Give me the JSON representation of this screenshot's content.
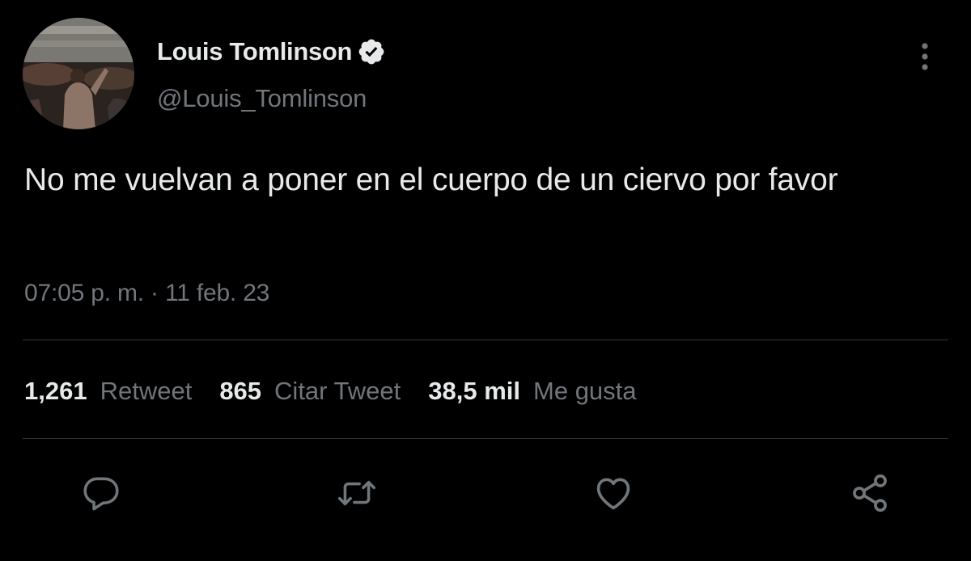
{
  "user": {
    "display_name": "Louis Tomlinson",
    "handle": "@Louis_Tomlinson",
    "verified_icon": "verified-badge-icon"
  },
  "menu": {
    "icon": "more-vertical-icon"
  },
  "tweet": {
    "text": "No me vuelvan a poner en el cuerpo de un ciervo por favor",
    "timestamp": "07:05 p. m. · 11 feb. 23"
  },
  "stats": {
    "retweets": {
      "count": "1,261",
      "label": "Retweet"
    },
    "quotes": {
      "count": "865",
      "label": "Citar Tweet"
    },
    "likes": {
      "count": "38,5 mil",
      "label": "Me gusta"
    }
  },
  "actions": [
    {
      "name": "reply",
      "icon": "reply-icon"
    },
    {
      "name": "retweet",
      "icon": "retweet-icon"
    },
    {
      "name": "like",
      "icon": "heart-icon"
    },
    {
      "name": "share",
      "icon": "share-icon"
    }
  ],
  "colors": {
    "background": "#000000",
    "primary_text": "#e7e9ea",
    "secondary_text": "#71767b",
    "divider": "#2f3336",
    "icon": "#71767b"
  }
}
